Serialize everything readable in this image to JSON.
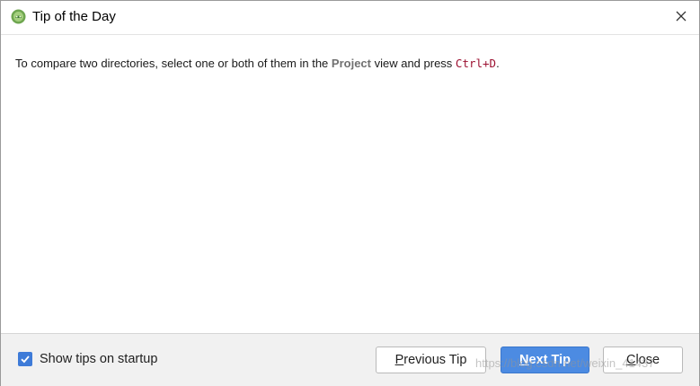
{
  "window": {
    "title": "Tip of the Day",
    "close_icon": "close-icon",
    "app_icon": "android-studio-icon"
  },
  "tip": {
    "prefix": "To compare two directories, select one or both of them in the ",
    "keyword": "Project",
    "middle": " view and press ",
    "shortcut": "Ctrl+D",
    "suffix": "."
  },
  "footer": {
    "show_tips_label": "Show tips on startup",
    "show_tips_checked": true,
    "previous_first": "P",
    "previous_rest": "revious Tip",
    "next_first": "N",
    "next_rest": "ext Tip",
    "close_first": "C",
    "close_rest": "lose",
    "watermark": "https://blog.csdn.net/weixin_41437"
  },
  "colors": {
    "accent": "#4c8be2",
    "checkbox": "#3e7bd8",
    "shortcut": "#9c1030",
    "keyword": "#707070",
    "footer_bg": "#f1f1f1"
  }
}
